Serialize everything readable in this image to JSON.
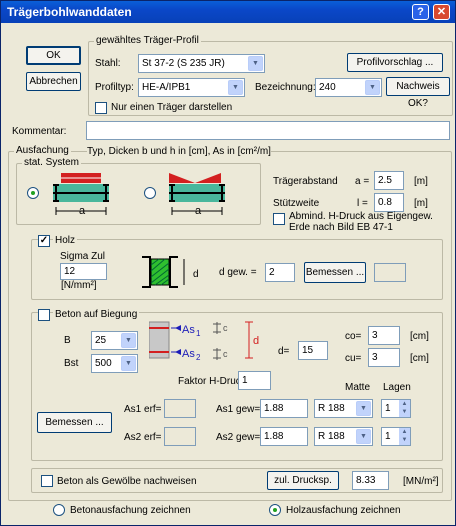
{
  "window": {
    "title": "Trägerbohlwanddaten",
    "help": "?",
    "close": "✕"
  },
  "buttons": {
    "ok": "OK",
    "cancel": "Abbrechen",
    "profile_suggest": "Profilvorschlag ...",
    "check": "Nachweis OK?",
    "dim_holz": "Bemessen ...",
    "dim_beton": "Bemessen ...",
    "allowable": "zul. Drucksp."
  },
  "profile": {
    "group": "gewähltes Träger-Profil",
    "steel_label": "Stahl:",
    "steel_value": "St 37-2 (S 235 JR)",
    "type_label": "Profiltyp:",
    "type_value": "HE-A/IPB1",
    "desig_label": "Bezeichnung:",
    "desig_value": "240",
    "single_label": "Nur einen Träger darstellen"
  },
  "comment_label": "Kommentar:",
  "lining": {
    "group": "Ausfachung",
    "units": "Typ, Dicken b und h in [cm], As in [cm²/m]"
  },
  "system": {
    "group": "stat. System",
    "spacing_label": "Trägerabstand",
    "spacing_eq": "a =",
    "spacing_value": "2.5",
    "spacing_unit": "[m]",
    "span_label": "Stützweite",
    "span_eq": "l =",
    "span_value": "0.8",
    "span_unit": "[m]",
    "min_label": "Abmind. H-Druck aus Eigengew.",
    "min_label2": "Erde nach Bild EB 47-1",
    "fig_a": "a"
  },
  "holz": {
    "label": "Holz",
    "sigma_label": "Sigma Zul",
    "sigma_value": "12",
    "sigma_unit": "[N/mm²]",
    "d_label": "d",
    "d_gew_label": "d gew. =",
    "d_gew_value": "2"
  },
  "beton": {
    "label": "Beton auf Biegung",
    "b_label": "B",
    "b_value": "25",
    "bst_label": "Bst",
    "bst_value": "500",
    "d_label": "d=",
    "d_value": "15",
    "co_label": "co=",
    "co_value": "3",
    "co_unit": "[cm]",
    "cu_label": "cu=",
    "cu_value": "3",
    "cu_unit": "[cm]",
    "faktor_label": "Faktor H-Druck:",
    "faktor_value": "1",
    "matte_header": "Matte",
    "lagen_header": "Lagen",
    "as1erf_label": "As1 erf=",
    "as2erf_label": "As2 erf=",
    "as1gew_label": "As1 gew=",
    "as1gew_value": "1.88",
    "as2gew_label": "As2 gew=",
    "as2gew_value": "1.88",
    "matte1": "R 188",
    "matte2": "R 188",
    "lagen1": "1",
    "lagen2": "1",
    "fig_as1": "As",
    "fig_as1_sub": "1",
    "fig_as2": "As",
    "fig_as2_sub": "2",
    "fig_c": "c",
    "fig_d": "d"
  },
  "gewoelbe": {
    "label": "Beton als Gewölbe nachweisen",
    "value": "8.33",
    "unit": "[MN/m²]"
  },
  "draw": {
    "beton": "Betonausfachung zeichnen",
    "holz": "Holzausfachung zeichnen"
  },
  "colors": {
    "title": "#0a47c8",
    "dialog": "#ece9d8",
    "accent": "#21a121"
  }
}
